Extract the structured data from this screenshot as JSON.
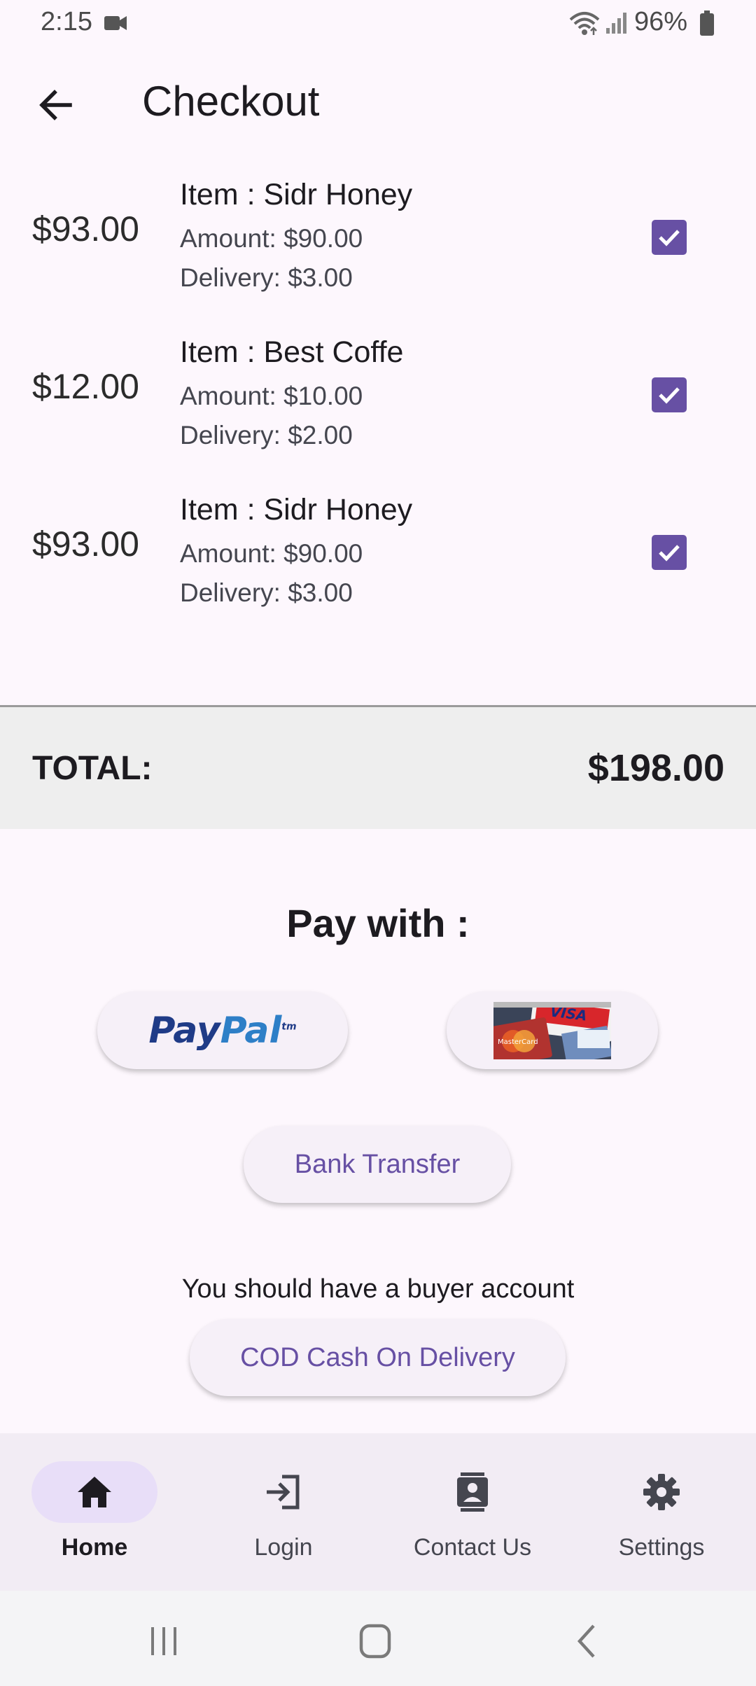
{
  "status_bar": {
    "time": "2:15",
    "battery": "96%",
    "icons": [
      "video-camera-icon",
      "wifi-icon",
      "signal-icon",
      "battery-icon"
    ]
  },
  "app_bar": {
    "title": "Checkout",
    "back_icon": "arrow-back-icon"
  },
  "items": [
    {
      "price": "$93.00",
      "name": "Item : Sidr Honey",
      "amount": "Amount: $90.00",
      "delivery": "Delivery: $3.00",
      "checked": true
    },
    {
      "price": "$12.00",
      "name": "Item : Best Coffe",
      "amount": "Amount: $10.00",
      "delivery": "Delivery: $2.00",
      "checked": true
    },
    {
      "price": "$93.00",
      "name": "Item : Sidr Honey",
      "amount": "Amount: $90.00",
      "delivery": "Delivery: $3.00",
      "checked": true
    }
  ],
  "total": {
    "label": "TOTAL:",
    "value": "$198.00"
  },
  "payment": {
    "title": "Pay with :",
    "paypal_part1": "Pay",
    "paypal_part2": "Pal",
    "paypal_tm": "tm",
    "card_visa": "VISA",
    "card_mastercard": "MasterCard",
    "bank_transfer": "Bank Transfer",
    "note": "You should have a buyer account",
    "cod": "COD  Cash On Delivery"
  },
  "bottom_nav": [
    {
      "label": "Home",
      "icon": "home-icon",
      "active": true
    },
    {
      "label": "Login",
      "icon": "login-icon",
      "active": false
    },
    {
      "label": "Contact Us",
      "icon": "contact-card-icon",
      "active": false
    },
    {
      "label": "Settings",
      "icon": "gear-icon",
      "active": false
    }
  ],
  "system_nav": [
    "recent-apps-icon",
    "home-circle-icon",
    "back-chevron-icon"
  ],
  "colors": {
    "background": "#fdf7fd",
    "accent": "#6750a4",
    "total_bar": "#eeeeee",
    "nav_bar": "#f2ecf4",
    "nav_indicator": "#e8def8"
  }
}
